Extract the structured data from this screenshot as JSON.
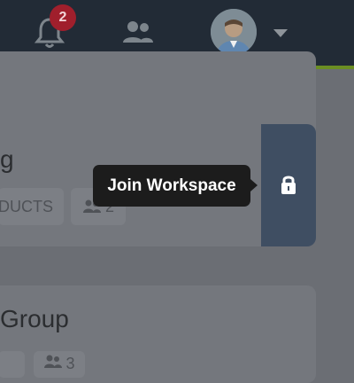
{
  "header": {
    "notifications": {
      "count": "2"
    },
    "icons": {
      "bell": "bell-icon",
      "people": "people-icon",
      "avatar": "avatar",
      "caret": "chevron-down-icon"
    },
    "colors": {
      "bar": "#283340",
      "accent": "#6b8e23",
      "badge": "#a01f2c"
    }
  },
  "workspace_card_1": {
    "title": "g",
    "tags": [
      {
        "label": "DUCTS"
      },
      {
        "label": "2"
      }
    ],
    "lock": {
      "icon": "lock-icon"
    }
  },
  "tooltip": {
    "label": "Join Workspace"
  },
  "workspace_card_2": {
    "title": "Group",
    "tags": [
      {
        "label": ""
      },
      {
        "label": "3"
      }
    ]
  }
}
